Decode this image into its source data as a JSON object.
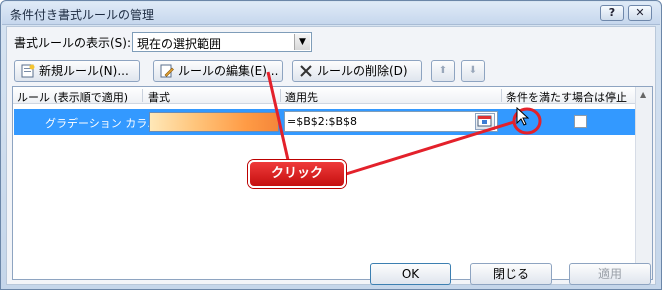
{
  "window": {
    "title": "条件付き書式ルールの管理",
    "help_glyph": "?",
    "close_glyph": "✕"
  },
  "show_rules": {
    "label": "書式ルールの表示(S):",
    "selected": "現在の選択範囲",
    "arrow": "▼"
  },
  "toolbar": {
    "new_rule": "新規ルール(N)...",
    "edit_rule": "ルールの編集(E)...",
    "delete_rule": "ルールの削除(D)",
    "up_glyph": "⬆",
    "down_glyph": "⬇"
  },
  "columns": [
    "ルール (表示順で適用)",
    "書式",
    "適用先",
    "条件を満たす場合は停止"
  ],
  "rows": [
    {
      "rule": "グラデーション カラ...",
      "applies_to": "=$B$2:$B$8"
    }
  ],
  "scroll": {
    "up": "▲",
    "down": "▼"
  },
  "buttons": {
    "ok": "OK",
    "close": "閉じる",
    "apply": "適用"
  },
  "callout": {
    "label": "クリック"
  },
  "colors": {
    "accent": "#e3212b",
    "selection": "#3399ff"
  }
}
